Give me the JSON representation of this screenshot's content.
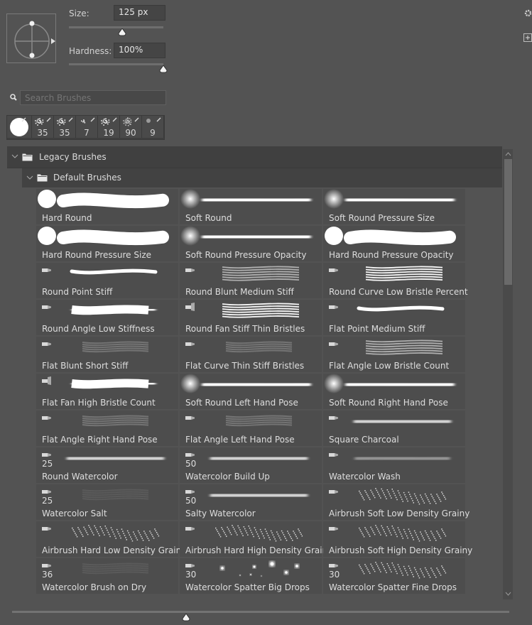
{
  "brush_settings": {
    "size_label": "Size:",
    "size_value": "125 px",
    "size_slider_fraction": 0.55,
    "hardness_label": "Hardness:",
    "hardness_value": "100%",
    "hardness_slider_fraction": 1.0
  },
  "side_icons": [
    "gear-icon",
    "new-preset-icon"
  ],
  "search": {
    "placeholder": "Search Brushes",
    "value": ""
  },
  "recent_brushes": [
    {
      "kind": "hard-round",
      "size": ""
    },
    {
      "kind": "splatter",
      "size": "35"
    },
    {
      "kind": "splatter",
      "size": "35"
    },
    {
      "kind": "small-splatter",
      "size": "7"
    },
    {
      "kind": "splatter",
      "size": "19"
    },
    {
      "kind": "grainy",
      "size": "90"
    },
    {
      "kind": "dot",
      "size": "9"
    }
  ],
  "groups": {
    "legacy": {
      "label": "Legacy Brushes",
      "expanded": true
    },
    "default": {
      "label": "Default Brushes",
      "expanded": true
    }
  },
  "brushes": [
    {
      "name": "Hard Round",
      "tip": "hard",
      "stroke": "hard",
      "size": ""
    },
    {
      "name": "Soft Round",
      "tip": "soft",
      "stroke": "soft",
      "size": ""
    },
    {
      "name": "Soft Round Pressure Size",
      "tip": "soft",
      "stroke": "soft",
      "size": ""
    },
    {
      "name": "Hard Round Pressure Size",
      "tip": "hard",
      "stroke": "hard",
      "size": ""
    },
    {
      "name": "Soft Round Pressure Opacity",
      "tip": "soft",
      "stroke": "soft",
      "size": ""
    },
    {
      "name": "Hard Round Pressure Opacity",
      "tip": "hard",
      "stroke": "hard",
      "size": ""
    },
    {
      "name": "Round Point Stiff",
      "tip": "bristle",
      "stroke": "thin",
      "size": ""
    },
    {
      "name": "Round Blunt Medium Stiff",
      "tip": "bristle",
      "stroke": "bristle",
      "size": ""
    },
    {
      "name": "Round Curve Low Bristle Percent",
      "tip": "bristle",
      "stroke": "bristle-bright",
      "size": ""
    },
    {
      "name": "Round Angle Low Stiffness",
      "tip": "bristle",
      "stroke": "heavy",
      "size": ""
    },
    {
      "name": "Round Fan Stiff Thin Bristles",
      "tip": "fan",
      "stroke": "bristle-bright",
      "size": ""
    },
    {
      "name": "Flat Point Medium Stiff",
      "tip": "bristle",
      "stroke": "thin",
      "size": ""
    },
    {
      "name": "Flat Blunt Short Stiff",
      "tip": "flat",
      "stroke": "faint",
      "size": ""
    },
    {
      "name": "Flat Curve Thin Stiff Bristles",
      "tip": "flat",
      "stroke": "faint",
      "size": ""
    },
    {
      "name": "Flat Angle Low Bristle Count",
      "tip": "flat",
      "stroke": "bristle",
      "size": ""
    },
    {
      "name": "Flat Fan High Bristle Count",
      "tip": "fan",
      "stroke": "heavy",
      "size": ""
    },
    {
      "name": "Soft Round Left Hand Pose",
      "tip": "soft",
      "stroke": "soft",
      "size": ""
    },
    {
      "name": "Soft Round Right Hand Pose",
      "tip": "soft",
      "stroke": "soft",
      "size": ""
    },
    {
      "name": "Flat Angle Right Hand Pose",
      "tip": "flat",
      "stroke": "faint",
      "size": ""
    },
    {
      "name": "Flat Angle Left Hand Pose",
      "tip": "flat",
      "stroke": "faint",
      "size": ""
    },
    {
      "name": "Square Charcoal",
      "tip": "pencil",
      "stroke": "grainy",
      "size": ""
    },
    {
      "name": "Round Watercolor",
      "tip": "pencil",
      "stroke": "grainy",
      "size": "25"
    },
    {
      "name": "Watercolor Build Up",
      "tip": "pencil",
      "stroke": "grainy",
      "size": "50"
    },
    {
      "name": "Watercolor Wash",
      "tip": "pencil",
      "stroke": "grainy-dim",
      "size": ""
    },
    {
      "name": "Watercolor Salt",
      "tip": "pencil",
      "stroke": "very-faint",
      "size": "25"
    },
    {
      "name": "Salty Watercolor",
      "tip": "pencil",
      "stroke": "grainy",
      "size": "50"
    },
    {
      "name": "Airbrush Soft Low Density Grainy",
      "tip": "pencil",
      "stroke": "spray",
      "size": ""
    },
    {
      "name": "Airbrush Hard Low Density Grainy",
      "tip": "pencil",
      "stroke": "spray",
      "size": ""
    },
    {
      "name": "Airbrush Hard High Density Grainy",
      "tip": "pencil",
      "stroke": "spray",
      "size": ""
    },
    {
      "name": "Airbrush Soft High Density Grainy",
      "tip": "pencil",
      "stroke": "spray",
      "size": ""
    },
    {
      "name": "Watercolor Brush on Dry",
      "tip": "flat",
      "stroke": "very-faint",
      "size": "36"
    },
    {
      "name": "Watercolor Spatter Big Drops",
      "tip": "pencil",
      "stroke": "drops",
      "size": "30"
    },
    {
      "name": "Watercolor Spatter Fine Drops",
      "tip": "pencil",
      "stroke": "spray",
      "size": "30"
    }
  ],
  "preview_size_slider_fraction": 0.35
}
